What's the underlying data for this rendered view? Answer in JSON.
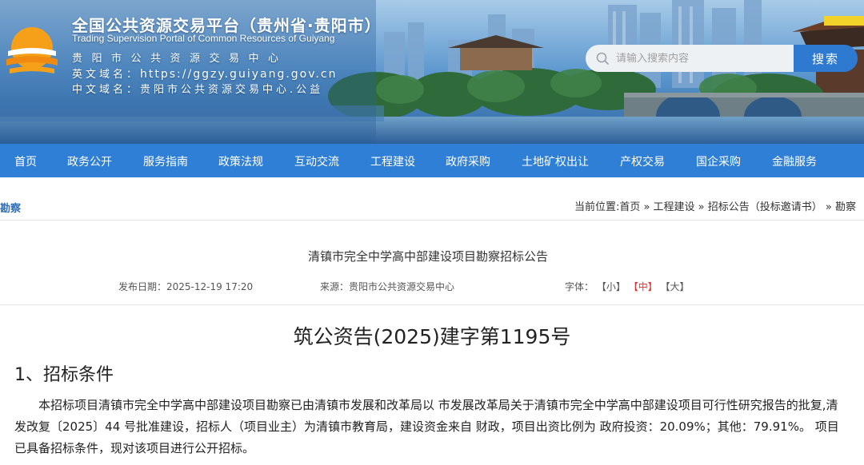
{
  "header": {
    "title": "全国公共资源交易平台（贵州省·贵阳市）",
    "subtitle_en": "Trading Supervision Portal of Common Resources of Guiyang",
    "org": "贵阳市公共资源交易中心",
    "en_domain_label": "英文域名：",
    "en_domain": "https://ggzy.guiyang.gov.cn",
    "cn_domain_label": "中文域名：",
    "cn_domain": "贵阳市公共资源交易中心.公益"
  },
  "search": {
    "placeholder": "请输入搜索内容",
    "button": "搜索",
    "icon": "search-icon"
  },
  "nav": {
    "items": [
      "首页",
      "政务公开",
      "服务指南",
      "政策法规",
      "互动交流",
      "工程建设",
      "政府采购",
      "土地矿权出让",
      "产权交易",
      "国企采购",
      "金融服务"
    ]
  },
  "breadcrumb": {
    "section": "勘察",
    "path": "当前位置:首页 » 工程建设 » 招标公告（投标邀请书） » 勘察"
  },
  "article": {
    "title": "清镇市完全中学高中部建设项目勘察招标公告",
    "date": "发布日期：2025-12-19 17:20",
    "source": "来源：贵阳市公共资源交易中心",
    "font_label": "字体：",
    "font_small": "【小】",
    "font_medium": "【中】",
    "font_large": "【大】",
    "doc_no": "筑公资告(2025)建字第1195号",
    "section1": "1、招标条件",
    "para1": "本招标项目清镇市完全中学高中部建设项目勘察已由清镇市发展和改革局以 市发展改革局关于清镇市完全中学高中部建设项目可行性研究报告的批复,清发改复〔2025〕44 号批准建设，招标人（项目业主）为清镇市教育局，建设资金来自 财政，项目出资比例为 政府投资：20.09%；其他：79.91%。 项目已具备招标条件，现对该项目进行公开招标。"
  },
  "colors": {
    "nav_bg": "#2f7fd6",
    "search_btn": "#2f7ad1",
    "font_active": "#e0312a",
    "crumb_section": "#2f6fb8"
  }
}
